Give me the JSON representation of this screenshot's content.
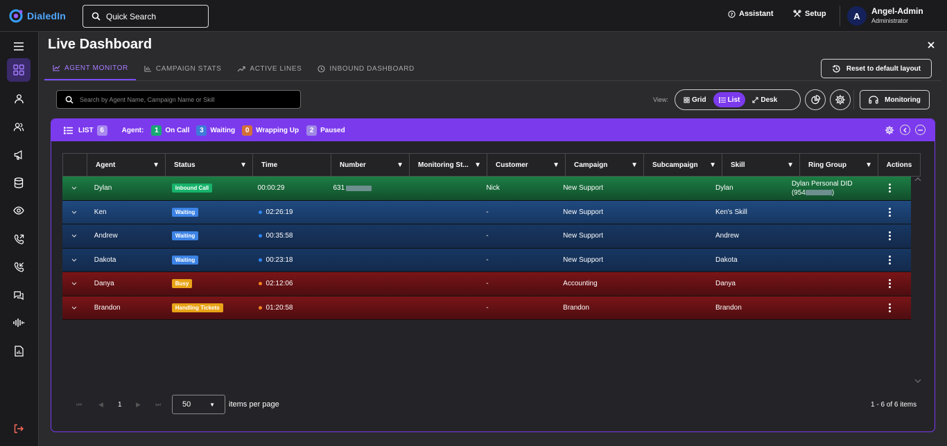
{
  "app": {
    "name": "DialedIn"
  },
  "topbar": {
    "search_label": "Quick Search",
    "assistant_label": "Assistant",
    "setup_label": "Setup",
    "user": {
      "initial": "A",
      "name": "Angel-Admin",
      "role": "Administrator"
    }
  },
  "sidebar": {
    "items": [
      "dashboard-icon",
      "user-icon",
      "users-icon",
      "megaphone-icon",
      "database-icon",
      "eye-icon",
      "outgoing-call-icon",
      "incoming-call-icon",
      "chat-icon",
      "audio-wave-icon",
      "report-icon"
    ],
    "active": 0,
    "logout": "logout-icon"
  },
  "page": {
    "title": "Live Dashboard"
  },
  "tabs": [
    {
      "label": "AGENT MONITOR",
      "active": true
    },
    {
      "label": "CAMPAIGN STATS",
      "active": false
    },
    {
      "label": "ACTIVE LINES",
      "active": false
    },
    {
      "label": "INBOUND DASHBOARD",
      "active": false
    }
  ],
  "reset_label": "Reset to default layout",
  "search": {
    "placeholder": "Search by Agent Name, Campaign Name or Skill"
  },
  "view": {
    "label": "View:",
    "options": [
      "Grid",
      "List",
      "Desk"
    ],
    "selected": "List"
  },
  "monitoring_label": "Monitoring",
  "panel": {
    "list_label": "LIST",
    "list_count": "6",
    "agent_label": "Agent:",
    "counts": [
      {
        "value": "1",
        "label": "On Call",
        "color": "#19a974"
      },
      {
        "value": "3",
        "label": "Waiting",
        "color": "#3d7bd9"
      },
      {
        "value": "0",
        "label": "Wrapping Up",
        "color": "#d3703a"
      },
      {
        "value": "2",
        "label": "Paused",
        "color": "#9f88e6"
      }
    ]
  },
  "columns": [
    "Agent",
    "Status",
    "Time",
    "Number",
    "Monitoring St...",
    "Customer",
    "Campaign",
    "Subcampaign",
    "Skill",
    "Ring Group",
    "Actions"
  ],
  "rows": [
    {
      "agent": "Dylan",
      "status": "Inbound Call",
      "status_color": "#18b36b",
      "time": "00:00:29",
      "dot": "",
      "number": "631",
      "customer": "Nick",
      "campaign": "New Support",
      "subcampaign": "",
      "skill": "Dylan",
      "ring_group": "Dylan Personal DID",
      "ring_group_number": "(954",
      "ring_group_suffix": ")",
      "theme": "green"
    },
    {
      "agent": "Ken",
      "status": "Waiting",
      "status_color": "#3c83e6",
      "time": "02:26:19",
      "dot": "#2f87ff",
      "number": "",
      "customer": "-",
      "campaign": "New Support",
      "subcampaign": "",
      "skill": "Ken's Skill",
      "ring_group": "",
      "theme": "blue1"
    },
    {
      "agent": "Andrew",
      "status": "Waiting",
      "status_color": "#3c83e6",
      "time": "00:35:58",
      "dot": "#2f87ff",
      "number": "",
      "customer": "-",
      "campaign": "New Support",
      "subcampaign": "",
      "skill": "Andrew",
      "ring_group": "",
      "theme": "blue2"
    },
    {
      "agent": "Dakota",
      "status": "Waiting",
      "status_color": "#3c83e6",
      "time": "00:23:18",
      "dot": "#2f87ff",
      "number": "",
      "customer": "-",
      "campaign": "New Support",
      "subcampaign": "",
      "skill": "Dakota",
      "ring_group": "",
      "theme": "blue2"
    },
    {
      "agent": "Danya",
      "status": "Busy",
      "status_color": "#e8a317",
      "time": "02:12:06",
      "dot": "#f5821f",
      "number": "",
      "customer": "-",
      "campaign": "Accounting",
      "subcampaign": "",
      "skill": "Danya",
      "ring_group": "",
      "theme": "red"
    },
    {
      "agent": "Brandon",
      "status": "Handling Tickets",
      "status_color": "#e8a317",
      "time": "01:20:58",
      "dot": "#f5821f",
      "number": "",
      "customer": "-",
      "campaign": "Brandon",
      "subcampaign": "",
      "skill": "Brandon",
      "ring_group": "",
      "theme": "red"
    }
  ],
  "pagination": {
    "page": "1",
    "per_page": "50",
    "per_page_label": "items per page",
    "summary": "1 - 6 of 6 items"
  }
}
